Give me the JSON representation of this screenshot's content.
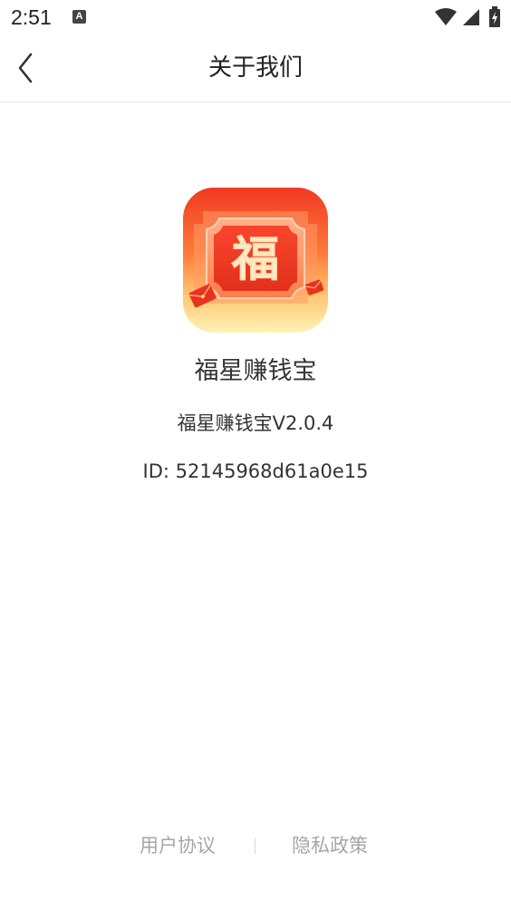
{
  "status_bar": {
    "time": "2:51",
    "notification_icon_letter": "A",
    "icons": [
      "wifi-icon",
      "signal-icon",
      "battery-charging-icon"
    ]
  },
  "header": {
    "back_icon": "chevron-left-icon",
    "title": "关于我们"
  },
  "app": {
    "icon_glyph": "福",
    "name": "福星赚钱宝",
    "version": "福星赚钱宝V2.0.4",
    "id": "ID: 52145968d61a0e15"
  },
  "footer": {
    "user_agreement": "用户协议",
    "privacy_policy": "隐私政策"
  },
  "colors": {
    "icon_red": "#f4442a",
    "icon_orange": "#ff8a3d",
    "icon_yellow": "#ffe9a0",
    "footer_text": "#a6a6a6",
    "divider": "#e6e6e6"
  }
}
